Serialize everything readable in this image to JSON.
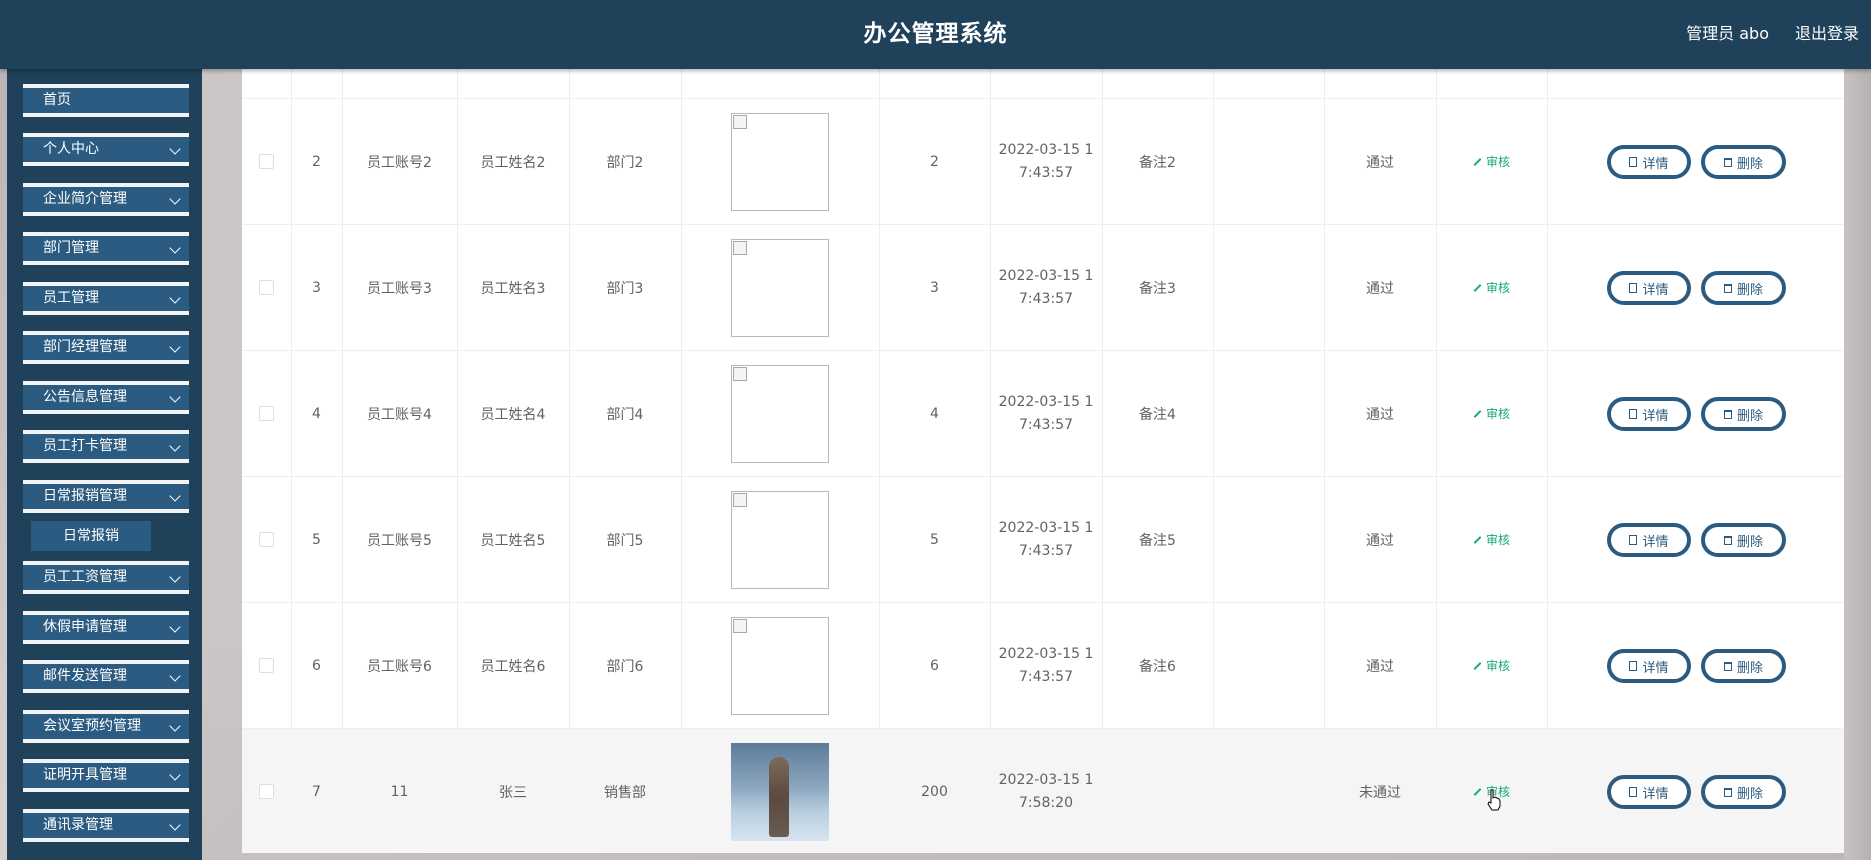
{
  "header": {
    "title": "办公管理系统",
    "admin_label": "管理员 abo",
    "logout_label": "退出登录"
  },
  "sidebar": {
    "items": [
      {
        "label": "首页",
        "has_submenu": false
      },
      {
        "label": "个人中心",
        "has_submenu": true
      },
      {
        "label": "企业简介管理",
        "has_submenu": true
      },
      {
        "label": "部门管理",
        "has_submenu": true
      },
      {
        "label": "员工管理",
        "has_submenu": true
      },
      {
        "label": "部门经理管理",
        "has_submenu": true
      },
      {
        "label": "公告信息管理",
        "has_submenu": true
      },
      {
        "label": "员工打卡管理",
        "has_submenu": true
      },
      {
        "label": "日常报销管理",
        "has_submenu": true
      },
      {
        "label": "员工工资管理",
        "has_submenu": true
      },
      {
        "label": "休假申请管理",
        "has_submenu": true
      },
      {
        "label": "邮件发送管理",
        "has_submenu": true
      },
      {
        "label": "会议室预约管理",
        "has_submenu": true
      },
      {
        "label": "证明开具管理",
        "has_submenu": true
      },
      {
        "label": "通讯录管理",
        "has_submenu": true
      }
    ],
    "active_submenu": "日常报销"
  },
  "table": {
    "audit_label": "审核",
    "detail_label": "详情",
    "delete_label": "删除",
    "rows": [
      {
        "index": "2",
        "account": "员工账号2",
        "name": "员工姓名2",
        "dept": "部门2",
        "image": "broken",
        "amount": "2",
        "time_line1": "2022-03-15 1",
        "time_line2": "7:43:57",
        "remark": "备注2",
        "status": "通过"
      },
      {
        "index": "3",
        "account": "员工账号3",
        "name": "员工姓名3",
        "dept": "部门3",
        "image": "broken",
        "amount": "3",
        "time_line1": "2022-03-15 1",
        "time_line2": "7:43:57",
        "remark": "备注3",
        "status": "通过"
      },
      {
        "index": "4",
        "account": "员工账号4",
        "name": "员工姓名4",
        "dept": "部门4",
        "image": "broken",
        "amount": "4",
        "time_line1": "2022-03-15 1",
        "time_line2": "7:43:57",
        "remark": "备注4",
        "status": "通过"
      },
      {
        "index": "5",
        "account": "员工账号5",
        "name": "员工姓名5",
        "dept": "部门5",
        "image": "broken",
        "amount": "5",
        "time_line1": "2022-03-15 1",
        "time_line2": "7:43:57",
        "remark": "备注5",
        "status": "通过"
      },
      {
        "index": "6",
        "account": "员工账号6",
        "name": "员工姓名6",
        "dept": "部门6",
        "image": "broken",
        "amount": "6",
        "time_line1": "2022-03-15 1",
        "time_line2": "7:43:57",
        "remark": "备注6",
        "status": "通过"
      },
      {
        "index": "7",
        "account": "11",
        "name": "张三",
        "dept": "销售部",
        "image": "photo",
        "amount": "200",
        "time_line1": "2022-03-15 1",
        "time_line2": "7:58:20",
        "remark": "",
        "status": "未通过"
      }
    ]
  },
  "colors": {
    "header_bg": "#1f4159",
    "menu_bg": "#2b5b80",
    "audit_green": "#17a97a"
  }
}
